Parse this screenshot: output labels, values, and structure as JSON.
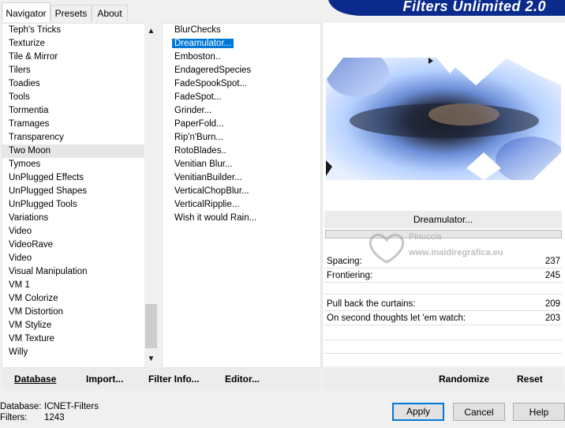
{
  "tabs": [
    {
      "label": "Navigator",
      "active": true
    },
    {
      "label": "Presets",
      "active": false
    },
    {
      "label": "About",
      "active": false
    }
  ],
  "banner_title": "Filters Unlimited 2.0",
  "categories": [
    "Teph's Tricks",
    "Texturize",
    "Tile & Mirror",
    "Tilers",
    "Toadies",
    "Tools",
    "Tormentia",
    "Tramages",
    "Transparency",
    "Two Moon",
    "Tymoes",
    "UnPlugged Effects",
    "UnPlugged Shapes",
    "UnPlugged Tools",
    "Variations",
    "Video",
    "VideoRave",
    "Video",
    "Visual Manipulation",
    "VM 1",
    "VM Colorize",
    "VM Distortion",
    "VM Stylize",
    "VM Texture",
    "Willy"
  ],
  "selected_category": "Two Moon",
  "filters": [
    "BlurChecks",
    "Dreamulator...",
    "Emboston..",
    "EndageredSpecies",
    "FadeSpookSpot...",
    "FadeSpot...",
    "Grinder...",
    "PaperFold...",
    "Rip'n'Burn...",
    "RotoBlades..",
    "Venitian Blur...",
    "VenitianBuilder...",
    "VerticalChopBlur...",
    "VerticalRipplie...",
    "Wish it would Rain..."
  ],
  "selected_filter": "Dreamulator...",
  "filter_name_button": "Dreamulator...",
  "params": [
    {
      "label": "Spacing:",
      "value": "237"
    },
    {
      "label": "Frontiering:",
      "value": "245"
    },
    {
      "label": "Pull back the curtains:",
      "value": "209"
    },
    {
      "label": "On second thoughts let 'em watch:",
      "value": "203"
    }
  ],
  "left_buttons": {
    "database": "Database",
    "import": "Import...",
    "filter_info": "Filter Info...",
    "editor": "Editor..."
  },
  "right_buttons": {
    "randomize": "Randomize",
    "reset": "Reset"
  },
  "status": {
    "database_label": "Database:",
    "database_value": "ICNET-Filters",
    "filters_label": "Filters:",
    "filters_value": "1243"
  },
  "dialog_buttons": {
    "apply": "Apply",
    "cancel": "Cancel",
    "help": "Help"
  },
  "watermark": {
    "line1": "Pinuccia",
    "line2": "www.maidiregrafica.eu"
  },
  "colors": {
    "selection": "#0078d7",
    "banner": "#0a2a8c",
    "default_button_border": "#0078d7"
  }
}
